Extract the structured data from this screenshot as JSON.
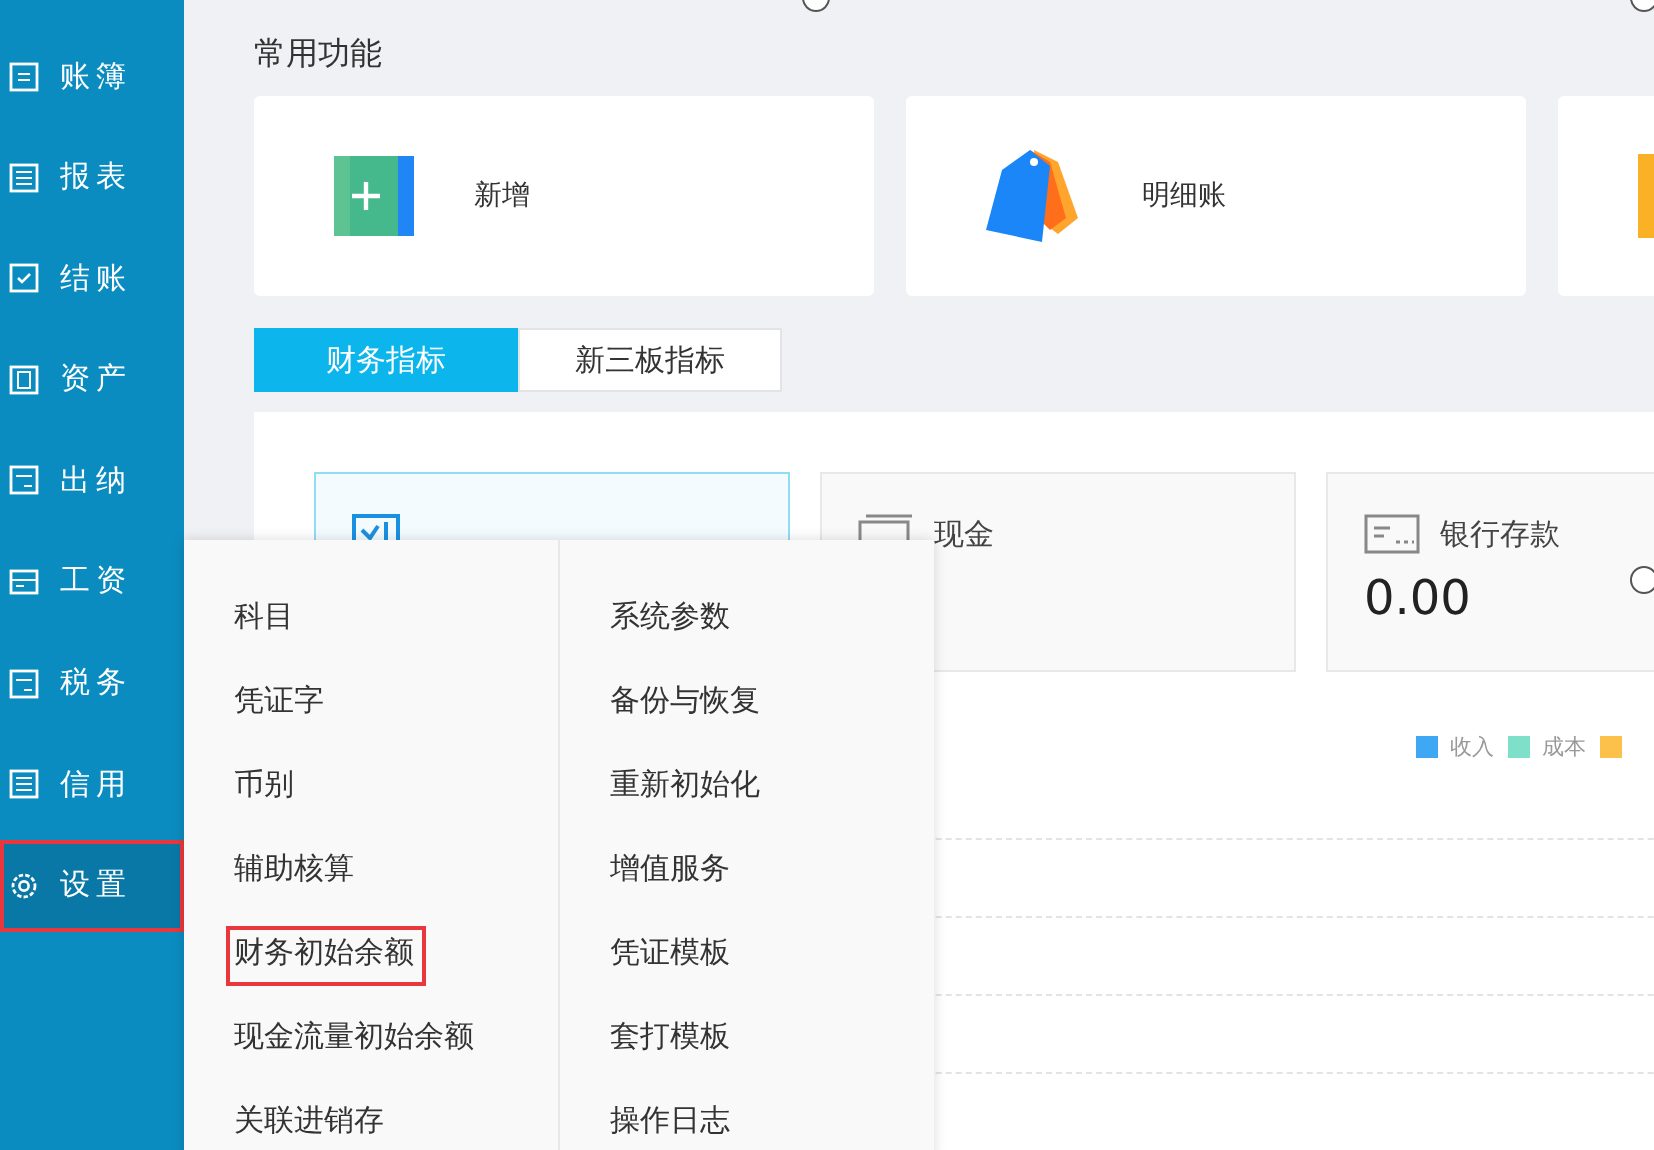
{
  "sidebar": {
    "items": [
      {
        "label": "账簿",
        "kind": "ledger",
        "selected": false,
        "marked": false
      },
      {
        "label": "报表",
        "kind": "list",
        "selected": false,
        "marked": false
      },
      {
        "label": "结账",
        "kind": "check",
        "selected": false,
        "marked": false
      },
      {
        "label": "资产",
        "kind": "doc",
        "selected": false,
        "marked": false
      },
      {
        "label": "出纳",
        "kind": "till",
        "selected": false,
        "marked": false
      },
      {
        "label": "工资",
        "kind": "card",
        "selected": false,
        "marked": false
      },
      {
        "label": "税务",
        "kind": "till",
        "selected": false,
        "marked": false
      },
      {
        "label": "信用",
        "kind": "list",
        "selected": false,
        "marked": false
      },
      {
        "label": "设置",
        "kind": "gear",
        "selected": true,
        "marked": true
      }
    ]
  },
  "quick_functions": {
    "title": "常用功能",
    "items": [
      {
        "label": "新增",
        "kind": "add"
      },
      {
        "label": "明细账",
        "kind": "tags"
      },
      {
        "kind": "book"
      }
    ]
  },
  "tabs": [
    {
      "label": "财务指标",
      "selected": true
    },
    {
      "label": "新三板指标",
      "selected": false
    }
  ],
  "metrics": [
    {
      "selected": true,
      "kind": "profit"
    },
    {
      "title": "现金",
      "selected": false,
      "kind": "cash"
    },
    {
      "title": "银行存款",
      "value": "0.00",
      "selected": false,
      "kind": "bank"
    }
  ],
  "legend": [
    {
      "label": "收入",
      "color": "#3ea8f5"
    },
    {
      "label": "成本",
      "color": "#7fe0c9"
    },
    {
      "color": "#fcc14a"
    }
  ],
  "settings_menu": {
    "columns": [
      [
        {
          "label": "科目",
          "marked": false
        },
        {
          "label": "凭证字",
          "marked": false
        },
        {
          "label": "币别",
          "marked": false
        },
        {
          "label": "辅助核算",
          "marked": false
        },
        {
          "label": "财务初始余额",
          "marked": true
        },
        {
          "label": "现金流量初始余额",
          "marked": false
        },
        {
          "label": "关联进销存",
          "marked": false
        }
      ],
      [
        {
          "label": "系统参数",
          "marked": false
        },
        {
          "label": "备份与恢复",
          "marked": false
        },
        {
          "label": "重新初始化",
          "marked": false
        },
        {
          "label": "增值服务",
          "marked": false
        },
        {
          "label": "凭证模板",
          "marked": false
        },
        {
          "label": "套打模板",
          "marked": false
        },
        {
          "label": "操作日志",
          "marked": false
        }
      ]
    ]
  }
}
